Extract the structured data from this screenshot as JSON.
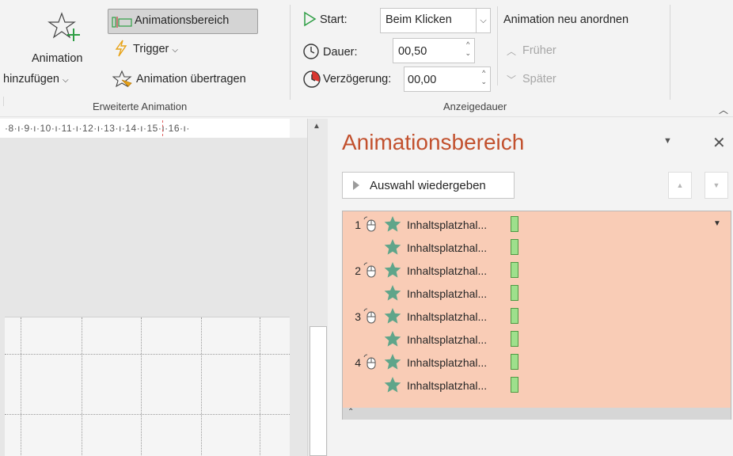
{
  "ribbon": {
    "add_animation_line1": "Animation",
    "add_animation_line2": "hinzufügen",
    "animation_pane_button": "Animationsbereich",
    "trigger_button": "Trigger",
    "animation_painter": "Animation übertragen",
    "group_advanced": "Erweiterte Animation",
    "start_label": "Start:",
    "start_value": "Beim Klicken",
    "duration_label": "Dauer:",
    "duration_value": "00,50",
    "delay_label": "Verzögerung:",
    "delay_value": "00,00",
    "reorder_title": "Animation neu anordnen",
    "move_earlier": "Früher",
    "move_later": "Später",
    "group_timing": "Anzeigedauer"
  },
  "ruler": {
    "text": "·8·ı·9·ı·10·ı·11·ı·12·ı·13·ı·14·ı·15·ı·16·ı·"
  },
  "pane": {
    "title": "Animationsbereich",
    "play_button": "Auswahl wiedergeben",
    "items": [
      {
        "number": "1",
        "label": "Inhaltsplatzhal..."
      },
      {
        "number": "",
        "label": "Inhaltsplatzhal..."
      },
      {
        "number": "2",
        "label": "Inhaltsplatzhal..."
      },
      {
        "number": "",
        "label": "Inhaltsplatzhal..."
      },
      {
        "number": "3",
        "label": "Inhaltsplatzhal..."
      },
      {
        "number": "",
        "label": "Inhaltsplatzhal..."
      },
      {
        "number": "4",
        "label": "Inhaltsplatzhal..."
      },
      {
        "number": "",
        "label": "Inhaltsplatzhal..."
      }
    ]
  },
  "colors": {
    "accent": "#c2512e",
    "list_background": "#f9ccb6",
    "star": "#5fa58a",
    "timeline_bar": "#9ee08c"
  }
}
